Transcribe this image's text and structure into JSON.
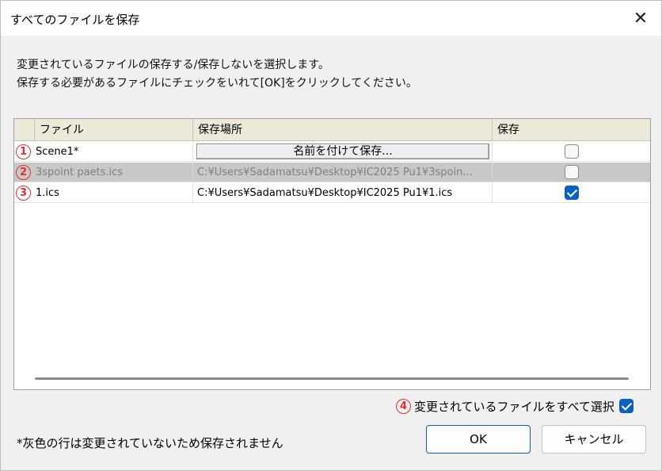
{
  "window": {
    "title": "すべてのファイルを保存",
    "close_glyph": "✕"
  },
  "instructions": [
    "変更されているファイルの保存する/保存しないを選択します。",
    "保存する必要があるファイルにチェックをいれて[OK]をクリックしてください。"
  ],
  "table": {
    "columns": [
      "ファイル",
      "保存場所",
      "保存"
    ],
    "rows": [
      {
        "marker": "1",
        "file": "Scene1*",
        "location_button": "名前を付けて保存...",
        "location": "",
        "save": false,
        "unchanged": false
      },
      {
        "marker": "2",
        "file": "3spoint paets.ics",
        "location_button": "",
        "location": "C:¥Users¥Sadamatsu¥Desktop¥IC2025 Pu1¥3spoin...",
        "save": false,
        "unchanged": true
      },
      {
        "marker": "3",
        "file": "1.ics",
        "location_button": "",
        "location": "C:¥Users¥Sadamatsu¥Desktop¥IC2025 Pu1¥1.ics",
        "save": true,
        "unchanged": false
      }
    ]
  },
  "select_all": {
    "marker": "4",
    "label": "変更されているファイルをすべて選択",
    "checked": true
  },
  "footer_note": "*灰色の行は変更されていないため保存されません",
  "buttons": {
    "ok": "OK",
    "cancel": "キャンセル"
  },
  "colors": {
    "accent": "#0a5fc4",
    "marker": "#e03030",
    "unchanged_row": "#c8c8c8",
    "header_bg": "#ece9d8"
  }
}
